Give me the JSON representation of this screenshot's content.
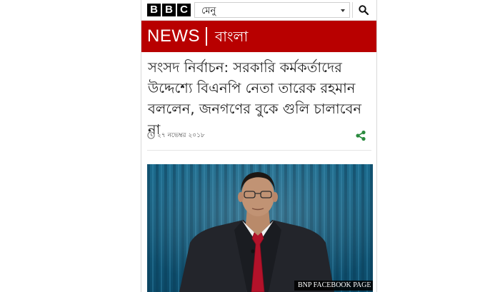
{
  "header": {
    "logo_letters": [
      "B",
      "B",
      "C"
    ],
    "menu_label": "মেনু",
    "search_icon": "search-icon",
    "caret_icon": "chevron-down-icon"
  },
  "news_banner": {
    "news": "NEWS",
    "language": "বাংলা",
    "color": "#b80000"
  },
  "article": {
    "headline": "সংসদ নির্বাচন: সরকারি কর্মকর্তাদের উদ্দেশ্যে বিএনপি নেতা তারেক রহমান বললেন, জনগণের বুকে গুলি চালাবেন না",
    "date": "২৭ নভেম্বর ২০১৮",
    "clock_icon": "clock-icon",
    "share_icon": "share-icon",
    "share_color": "#2a8a3e"
  },
  "image": {
    "caption": "BNP FACEBOOK PAGE"
  }
}
